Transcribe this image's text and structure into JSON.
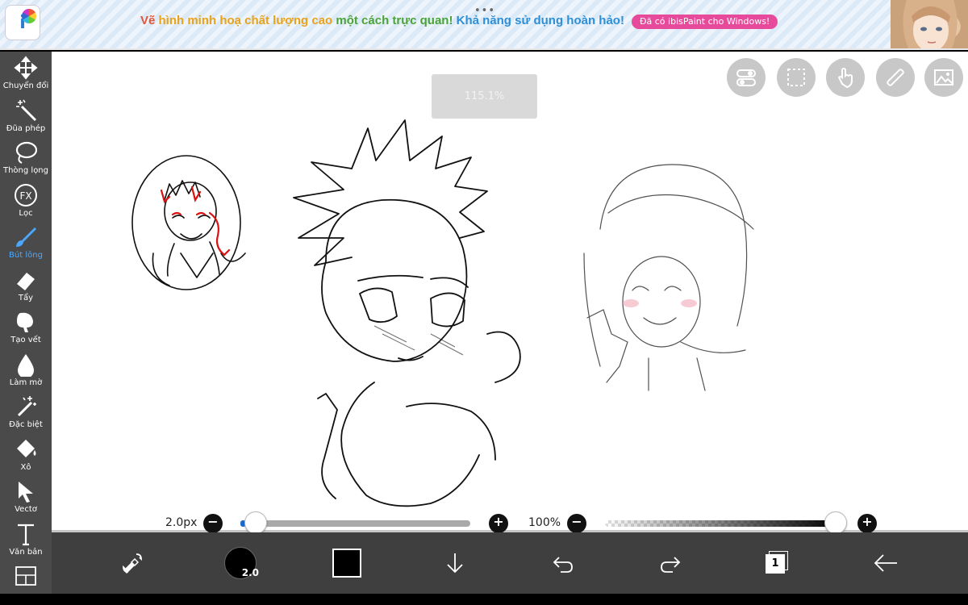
{
  "banner": {
    "headline_parts": [
      {
        "text": "Vẽ ",
        "color": "#e0563b"
      },
      {
        "text": "hình minh hoạ chất lượng cao ",
        "color": "#e8a31a"
      },
      {
        "text": "một cách trực quan! ",
        "color": "#4aa338"
      },
      {
        "text": "Khả năng sử dụng hoàn hảo!",
        "color": "#2d8fd6"
      }
    ],
    "cta": "Đã có ibisPaint cho Windows!",
    "logo_letter": "i",
    "menu_dots": "•••"
  },
  "canvas": {
    "zoom_text": "115.1%"
  },
  "top_buttons": [
    "toggle-icon",
    "selection-icon",
    "hand-icon",
    "ruler-icon",
    "reference-image-icon"
  ],
  "tools": [
    {
      "name": "transform",
      "label": "Chuyển đổi",
      "icon": "move-arrows-icon",
      "active": false
    },
    {
      "name": "magic-wand",
      "label": "Đũa phép",
      "icon": "magic-wand-icon",
      "active": false
    },
    {
      "name": "lasso",
      "label": "Thòng lọng",
      "icon": "lasso-icon",
      "active": false
    },
    {
      "name": "filter",
      "label": "Lọc",
      "icon": "fx-icon",
      "active": false
    },
    {
      "name": "brush",
      "label": "Bút lông",
      "icon": "brush-icon",
      "active": true
    },
    {
      "name": "eraser",
      "label": "Tẩy",
      "icon": "eraser-icon",
      "active": false
    },
    {
      "name": "smudge",
      "label": "Tạo vết",
      "icon": "smudge-icon",
      "active": false
    },
    {
      "name": "blur",
      "label": "Làm mờ",
      "icon": "blur-drop-icon",
      "active": false
    },
    {
      "name": "special",
      "label": "Đặc biệt",
      "icon": "sparkle-wand-icon",
      "active": false
    },
    {
      "name": "fill",
      "label": "Xô",
      "icon": "bucket-icon",
      "active": false
    },
    {
      "name": "vector",
      "label": "Vectơ",
      "icon": "vector-cursor-icon",
      "active": false
    },
    {
      "name": "text",
      "label": "Văn bản",
      "icon": "text-icon",
      "active": false
    },
    {
      "name": "frame",
      "label": "",
      "icon": "frame-divider-icon",
      "active": false
    }
  ],
  "sliders": {
    "size_label": "2.0px",
    "size_fraction": 0.02,
    "opacity_label": "100%",
    "opacity_fraction": 1.0,
    "minus": "−",
    "plus": "+"
  },
  "bottom_bar": {
    "brush_size_badge": "2.0",
    "layer_count": "1",
    "color": "#000000"
  }
}
